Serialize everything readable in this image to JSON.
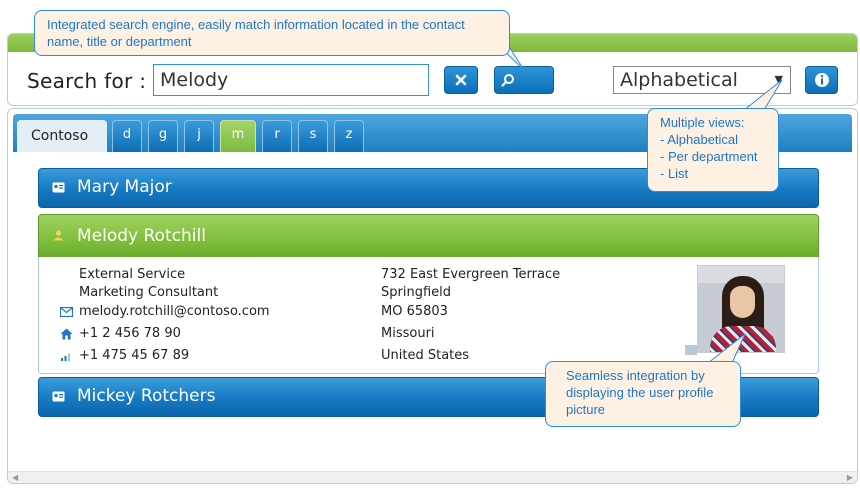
{
  "search": {
    "label": "Search for :",
    "value": "Melody",
    "clear_icon": "close-icon",
    "search_icon": "search-icon"
  },
  "view_select": {
    "selected": "Alphabetical",
    "arrow": "▼"
  },
  "info_icon": "info-icon",
  "tabs": {
    "company": "Contoso",
    "letters": [
      "d",
      "g",
      "j",
      "m",
      "r",
      "s",
      "z"
    ],
    "active": "m"
  },
  "contacts": [
    {
      "name": "Mary Major",
      "icon": "contact-card-icon",
      "expanded": false
    },
    {
      "name": "Melody Rotchill",
      "icon": "user-icon",
      "expanded": true,
      "department": "External Service",
      "title": "Marketing Consultant",
      "email": "melody.rotchill@contoso.com",
      "phone": "+1 2 456 78 90",
      "mobile": "+1 475 45 67 89",
      "address": {
        "street": "732 East Evergreen Terrace",
        "city": "Springfield",
        "postal": "MO 65803",
        "state": "Missouri",
        "country": "United States"
      }
    },
    {
      "name": "Mickey Rotchers",
      "icon": "contact-card-icon",
      "expanded": false
    }
  ],
  "callouts": {
    "search": "Integrated search engine, easily match information located in the contact name, title or department",
    "views_title": "Multiple views:",
    "views": [
      "- Alphabetical",
      "- Per department",
      "- List"
    ],
    "photo": "Seamless integration by displaying the user profile picture"
  },
  "colors": {
    "accent_blue": "#1679c2",
    "accent_green": "#7fbf3c",
    "callout_bg": "#fdf1e4",
    "callout_text": "#1f76c8"
  }
}
